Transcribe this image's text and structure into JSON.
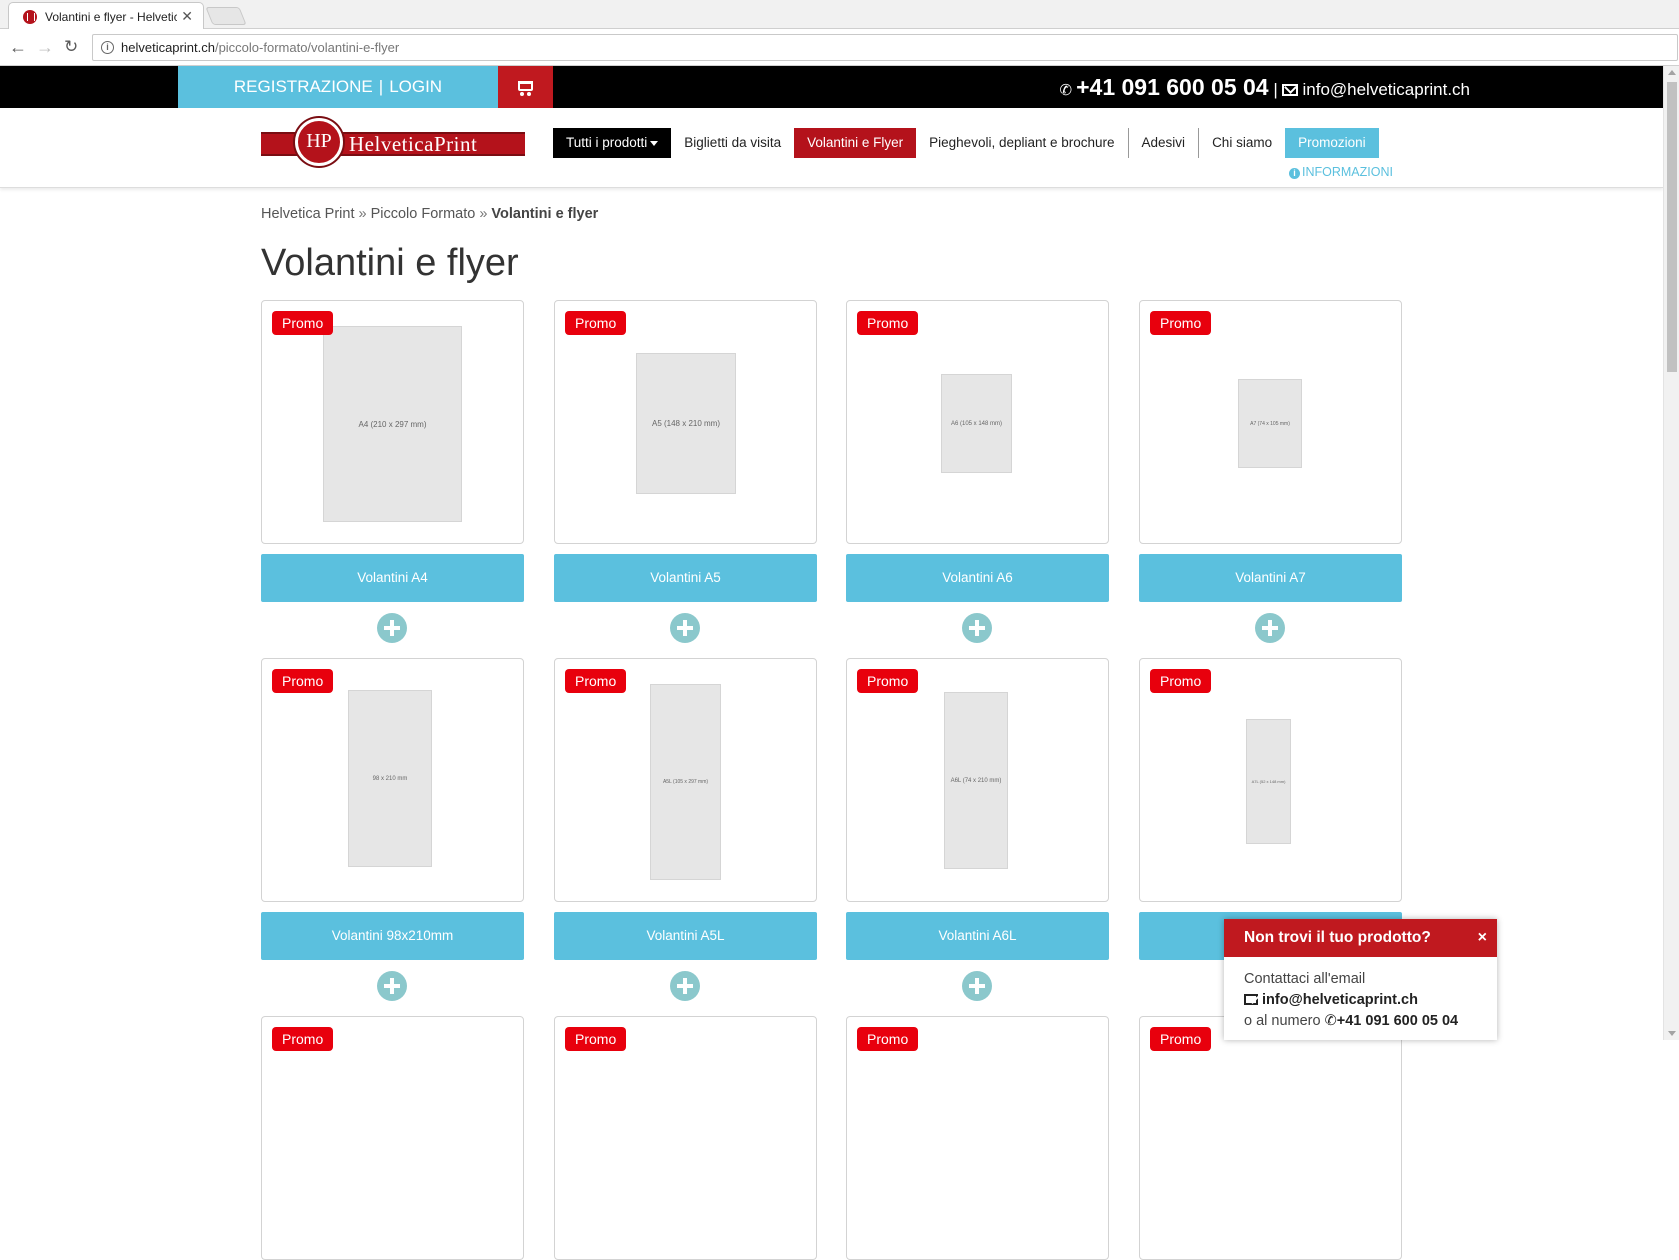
{
  "browser": {
    "tab_title": "Volantini e flyer - Helvetica",
    "url_domain": "helveticaprint.ch",
    "url_path": "/piccolo-formato/volantini-e-flyer"
  },
  "topbar": {
    "registrazione": "REGISTRAZIONE",
    "separator": "|",
    "login": "LOGIN",
    "phone": "+41 091 600 05 04",
    "contact_separator": "|",
    "email": "info@helveticaprint.ch"
  },
  "header": {
    "logo_text": "HelveticaPrint",
    "logo_monogram": "HP",
    "menu": [
      {
        "label": "Tutti i prodotti"
      },
      {
        "label": "Biglietti da visita"
      },
      {
        "label": "Volantini e Flyer"
      },
      {
        "label": "Pieghevoli, depliant e brochure"
      },
      {
        "label": "Adesivi"
      },
      {
        "label": "Chi siamo"
      },
      {
        "label": "Promozioni"
      }
    ],
    "informazioni": "INFORMAZIONI"
  },
  "breadcrumb": {
    "items": [
      "Helvetica Print",
      "Piccolo Formato"
    ],
    "separator": "»",
    "current": "Volantini e flyer"
  },
  "page_title": "Volantini e flyer",
  "promo_label": "Promo",
  "products": [
    {
      "name": "Volantini A4",
      "mock_label": "A4 (210 x 297 mm)"
    },
    {
      "name": "Volantini A5",
      "mock_label": "A5 (148 x 210 mm)"
    },
    {
      "name": "Volantini A6",
      "mock_label": "A6 (105 x 148 mm)"
    },
    {
      "name": "Volantini A7",
      "mock_label": "A7 (74 x 105 mm)"
    },
    {
      "name": "Volantini 98x210mm",
      "mock_label": "98 x 210 mm"
    },
    {
      "name": "Volantini A5L",
      "mock_label": "A5L (105 x 297 mm)"
    },
    {
      "name": "Volantini A6L",
      "mock_label": "A6L (74 x 210 mm)"
    },
    {
      "name": "",
      "mock_label": "A7L (52 x 148 mm)"
    }
  ],
  "popup": {
    "title": "Non trovi il tuo prodotto?",
    "close": "×",
    "line1": "Contattaci all'email",
    "email": "info@helveticaprint.ch",
    "line3": "o al numero",
    "phone": "+41 091 600 05 04"
  },
  "colors": {
    "accent_blue": "#5bc0de",
    "brand_red": "#b4121b",
    "promo_red": "#e8000d"
  }
}
